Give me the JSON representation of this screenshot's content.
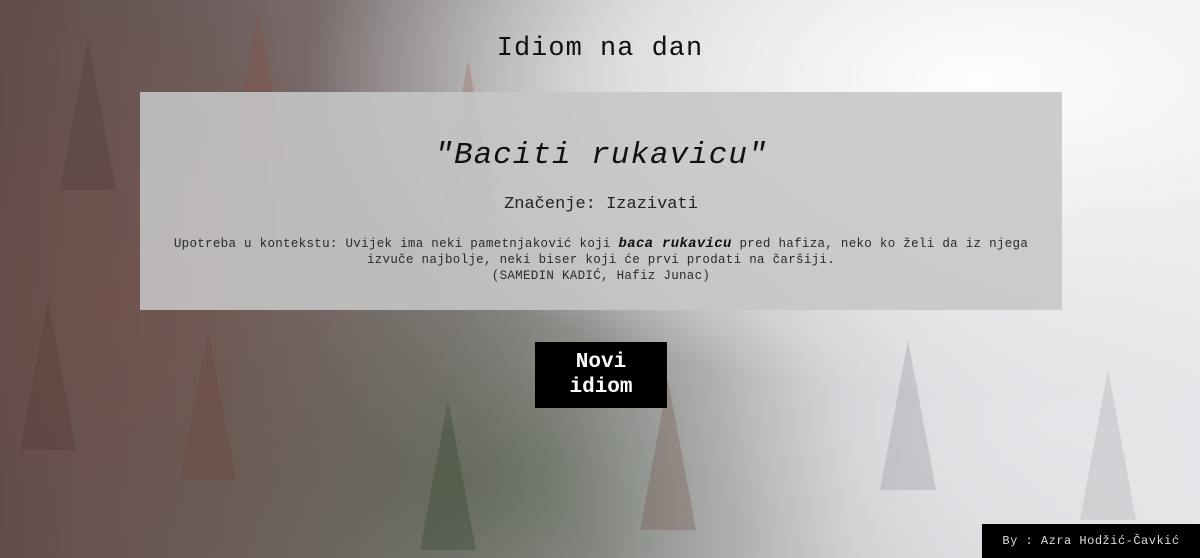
{
  "page": {
    "title": "Idiom na dan"
  },
  "idiom_card": {
    "idiom": "\"Baciti rukavicu\"",
    "meaning_label": "Značenje:",
    "meaning": "Izazivati",
    "context_label": "Upotreba u kontekstu:",
    "context_before": "Uvijek ima neki pametnjaković koji",
    "context_highlight": "baca rukavicu",
    "context_after": "pred hafiza, neko ko želi da iz njega izvuče najbolje, neki biser koji će prvi prodati na čaršiji.",
    "source": "(SAMEDIN KADIĆ, Hafiz Junac)"
  },
  "button": {
    "label": "Novi idiom"
  },
  "footer": {
    "credit": "By : Azra Hodžić-Čavkić"
  },
  "colors": {
    "card_background": "#c6c6c6",
    "button_background": "#000000",
    "button_text": "#ffffff",
    "footer_background": "#000000"
  }
}
